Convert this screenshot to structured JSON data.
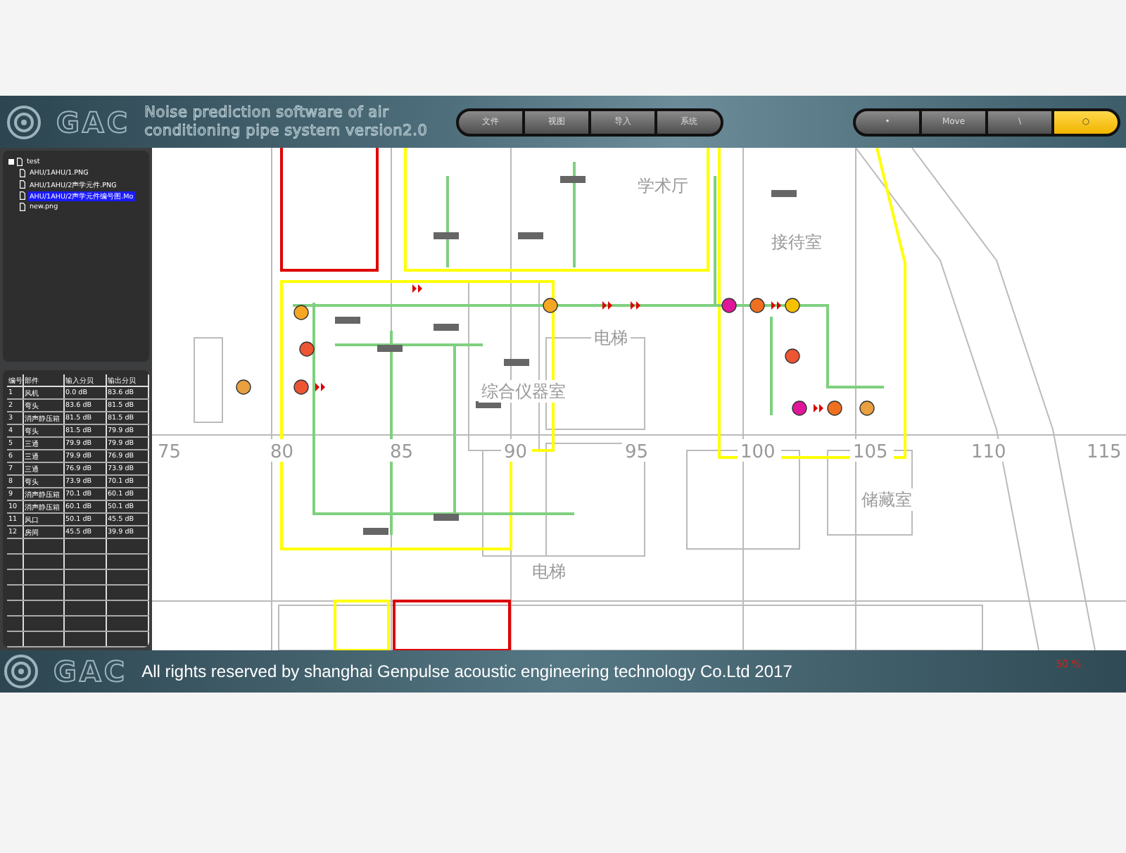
{
  "header": {
    "logo": "GAC",
    "title_line_1": "Noise prediction software of air",
    "title_line_2": "conditioning pipe system version2.0"
  },
  "menu": [
    "文件",
    "视图",
    "导入",
    "系统"
  ],
  "tools": [
    {
      "label": "•",
      "selected": false
    },
    {
      "label": "Move",
      "selected": false
    },
    {
      "label": "\\",
      "selected": false
    },
    {
      "label": "○",
      "selected": true
    }
  ],
  "file_tree": {
    "label": "test",
    "children": [
      {
        "label": "AHU/1AHU/1.PNG",
        "selected": false
      },
      {
        "label": "AHU/1AHU/2声学元件.PNG",
        "selected": false
      },
      {
        "label": "AHU/1AHU/2声学元件编号图.Mo",
        "selected": true
      },
      {
        "label": "new.png",
        "selected": false
      }
    ]
  },
  "table": {
    "columns": [
      "编号",
      "部件",
      "输入分贝",
      "输出分贝"
    ],
    "rows": [
      [
        "1",
        "风机",
        "0.0 dB",
        "83.6 dB"
      ],
      [
        "2",
        "弯头",
        "83.6 dB",
        "81.5 dB"
      ],
      [
        "3",
        "消声静压箱",
        "81.5 dB",
        "81.5 dB"
      ],
      [
        "4",
        "弯头",
        "81.5 dB",
        "79.9 dB"
      ],
      [
        "5",
        "三通",
        "79.9 dB",
        "79.9 dB"
      ],
      [
        "6",
        "三通",
        "79.9 dB",
        "76.9 dB"
      ],
      [
        "7",
        "三通",
        "76.9 dB",
        "73.9 dB"
      ],
      [
        "8",
        "弯头",
        "73.9 dB",
        "70.1 dB"
      ],
      [
        "9",
        "消声静压箱",
        "70.1 dB",
        "60.1 dB"
      ],
      [
        "10",
        "消声静压箱",
        "60.1 dB",
        "50.1 dB"
      ],
      [
        "11",
        "风口",
        "50.1 dB",
        "45.5 dB"
      ],
      [
        "12",
        "房间",
        "45.5 dB",
        "39.9 dB"
      ]
    ]
  },
  "floor_plan": {
    "room_labels": [
      "学术厅",
      "接待室",
      "综合仪器室",
      "电梯",
      "电梯",
      "储藏室"
    ],
    "axis_labels": [
      "75",
      "80",
      "85",
      "90",
      "95",
      "100",
      "105",
      "110",
      "115"
    ]
  },
  "footer": {
    "logo": "GAC",
    "copyright": "All rights reserved by shanghai Genpulse acoustic engineering technology Co.Ltd 2017",
    "zoom": "50 %"
  }
}
